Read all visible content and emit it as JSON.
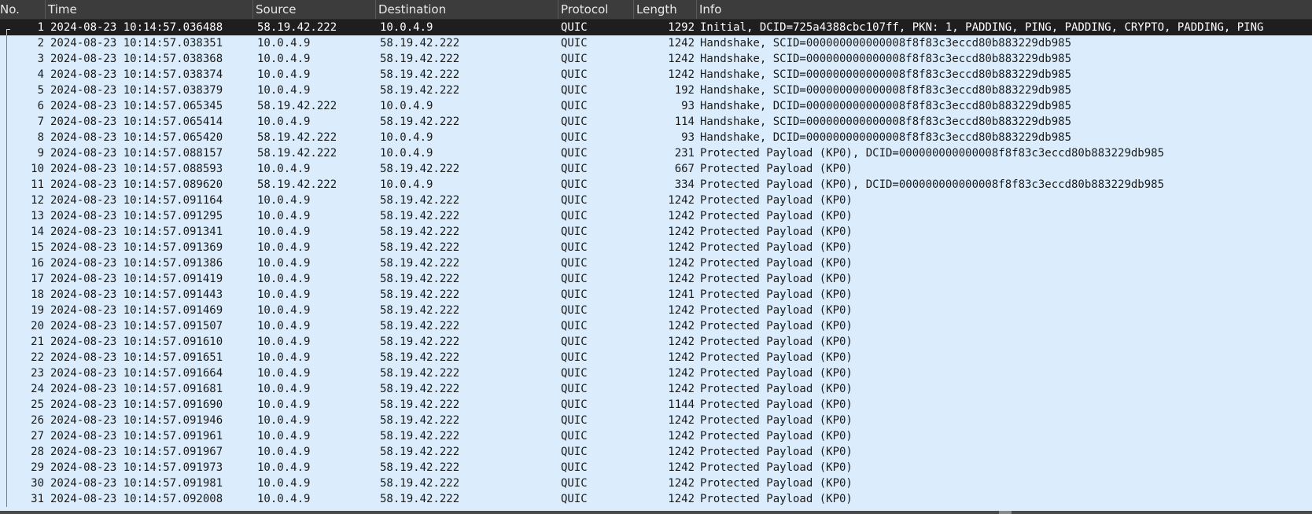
{
  "columns": {
    "no": "No.",
    "time": "Time",
    "source": "Source",
    "destination": "Destination",
    "protocol": "Protocol",
    "length": "Length",
    "info": "Info"
  },
  "selected_row": 1,
  "packets": [
    {
      "no": "1",
      "time": "2024-08-23 10:14:57.036488",
      "source": "58.19.42.222",
      "destination": "10.0.4.9",
      "protocol": "QUIC",
      "length": "1292",
      "info": "Initial, DCID=725a4388cbc107ff, PKN: 1, PADDING, PING, PADDING, CRYPTO, PADDING, PING"
    },
    {
      "no": "2",
      "time": "2024-08-23 10:14:57.038351",
      "source": "10.0.4.9",
      "destination": "58.19.42.222",
      "protocol": "QUIC",
      "length": "1242",
      "info": "Handshake, SCID=000000000000008f8f83c3eccd80b883229db985"
    },
    {
      "no": "3",
      "time": "2024-08-23 10:14:57.038368",
      "source": "10.0.4.9",
      "destination": "58.19.42.222",
      "protocol": "QUIC",
      "length": "1242",
      "info": "Handshake, SCID=000000000000008f8f83c3eccd80b883229db985"
    },
    {
      "no": "4",
      "time": "2024-08-23 10:14:57.038374",
      "source": "10.0.4.9",
      "destination": "58.19.42.222",
      "protocol": "QUIC",
      "length": "1242",
      "info": "Handshake, SCID=000000000000008f8f83c3eccd80b883229db985"
    },
    {
      "no": "5",
      "time": "2024-08-23 10:14:57.038379",
      "source": "10.0.4.9",
      "destination": "58.19.42.222",
      "protocol": "QUIC",
      "length": "192",
      "info": "Handshake, SCID=000000000000008f8f83c3eccd80b883229db985"
    },
    {
      "no": "6",
      "time": "2024-08-23 10:14:57.065345",
      "source": "58.19.42.222",
      "destination": "10.0.4.9",
      "protocol": "QUIC",
      "length": "93",
      "info": "Handshake, DCID=000000000000008f8f83c3eccd80b883229db985"
    },
    {
      "no": "7",
      "time": "2024-08-23 10:14:57.065414",
      "source": "10.0.4.9",
      "destination": "58.19.42.222",
      "protocol": "QUIC",
      "length": "114",
      "info": "Handshake, SCID=000000000000008f8f83c3eccd80b883229db985"
    },
    {
      "no": "8",
      "time": "2024-08-23 10:14:57.065420",
      "source": "58.19.42.222",
      "destination": "10.0.4.9",
      "protocol": "QUIC",
      "length": "93",
      "info": "Handshake, DCID=000000000000008f8f83c3eccd80b883229db985"
    },
    {
      "no": "9",
      "time": "2024-08-23 10:14:57.088157",
      "source": "58.19.42.222",
      "destination": "10.0.4.9",
      "protocol": "QUIC",
      "length": "231",
      "info": "Protected Payload (KP0), DCID=000000000000008f8f83c3eccd80b883229db985"
    },
    {
      "no": "10",
      "time": "2024-08-23 10:14:57.088593",
      "source": "10.0.4.9",
      "destination": "58.19.42.222",
      "protocol": "QUIC",
      "length": "667",
      "info": "Protected Payload (KP0)"
    },
    {
      "no": "11",
      "time": "2024-08-23 10:14:57.089620",
      "source": "58.19.42.222",
      "destination": "10.0.4.9",
      "protocol": "QUIC",
      "length": "334",
      "info": "Protected Payload (KP0), DCID=000000000000008f8f83c3eccd80b883229db985"
    },
    {
      "no": "12",
      "time": "2024-08-23 10:14:57.091164",
      "source": "10.0.4.9",
      "destination": "58.19.42.222",
      "protocol": "QUIC",
      "length": "1242",
      "info": "Protected Payload (KP0)"
    },
    {
      "no": "13",
      "time": "2024-08-23 10:14:57.091295",
      "source": "10.0.4.9",
      "destination": "58.19.42.222",
      "protocol": "QUIC",
      "length": "1242",
      "info": "Protected Payload (KP0)"
    },
    {
      "no": "14",
      "time": "2024-08-23 10:14:57.091341",
      "source": "10.0.4.9",
      "destination": "58.19.42.222",
      "protocol": "QUIC",
      "length": "1242",
      "info": "Protected Payload (KP0)"
    },
    {
      "no": "15",
      "time": "2024-08-23 10:14:57.091369",
      "source": "10.0.4.9",
      "destination": "58.19.42.222",
      "protocol": "QUIC",
      "length": "1242",
      "info": "Protected Payload (KP0)"
    },
    {
      "no": "16",
      "time": "2024-08-23 10:14:57.091386",
      "source": "10.0.4.9",
      "destination": "58.19.42.222",
      "protocol": "QUIC",
      "length": "1242",
      "info": "Protected Payload (KP0)"
    },
    {
      "no": "17",
      "time": "2024-08-23 10:14:57.091419",
      "source": "10.0.4.9",
      "destination": "58.19.42.222",
      "protocol": "QUIC",
      "length": "1242",
      "info": "Protected Payload (KP0)"
    },
    {
      "no": "18",
      "time": "2024-08-23 10:14:57.091443",
      "source": "10.0.4.9",
      "destination": "58.19.42.222",
      "protocol": "QUIC",
      "length": "1241",
      "info": "Protected Payload (KP0)"
    },
    {
      "no": "19",
      "time": "2024-08-23 10:14:57.091469",
      "source": "10.0.4.9",
      "destination": "58.19.42.222",
      "protocol": "QUIC",
      "length": "1242",
      "info": "Protected Payload (KP0)"
    },
    {
      "no": "20",
      "time": "2024-08-23 10:14:57.091507",
      "source": "10.0.4.9",
      "destination": "58.19.42.222",
      "protocol": "QUIC",
      "length": "1242",
      "info": "Protected Payload (KP0)"
    },
    {
      "no": "21",
      "time": "2024-08-23 10:14:57.091610",
      "source": "10.0.4.9",
      "destination": "58.19.42.222",
      "protocol": "QUIC",
      "length": "1242",
      "info": "Protected Payload (KP0)"
    },
    {
      "no": "22",
      "time": "2024-08-23 10:14:57.091651",
      "source": "10.0.4.9",
      "destination": "58.19.42.222",
      "protocol": "QUIC",
      "length": "1242",
      "info": "Protected Payload (KP0)"
    },
    {
      "no": "23",
      "time": "2024-08-23 10:14:57.091664",
      "source": "10.0.4.9",
      "destination": "58.19.42.222",
      "protocol": "QUIC",
      "length": "1242",
      "info": "Protected Payload (KP0)"
    },
    {
      "no": "24",
      "time": "2024-08-23 10:14:57.091681",
      "source": "10.0.4.9",
      "destination": "58.19.42.222",
      "protocol": "QUIC",
      "length": "1242",
      "info": "Protected Payload (KP0)"
    },
    {
      "no": "25",
      "time": "2024-08-23 10:14:57.091690",
      "source": "10.0.4.9",
      "destination": "58.19.42.222",
      "protocol": "QUIC",
      "length": "1144",
      "info": "Protected Payload (KP0)"
    },
    {
      "no": "26",
      "time": "2024-08-23 10:14:57.091946",
      "source": "10.0.4.9",
      "destination": "58.19.42.222",
      "protocol": "QUIC",
      "length": "1242",
      "info": "Protected Payload (KP0)"
    },
    {
      "no": "27",
      "time": "2024-08-23 10:14:57.091961",
      "source": "10.0.4.9",
      "destination": "58.19.42.222",
      "protocol": "QUIC",
      "length": "1242",
      "info": "Protected Payload (KP0)"
    },
    {
      "no": "28",
      "time": "2024-08-23 10:14:57.091967",
      "source": "10.0.4.9",
      "destination": "58.19.42.222",
      "protocol": "QUIC",
      "length": "1242",
      "info": "Protected Payload (KP0)"
    },
    {
      "no": "29",
      "time": "2024-08-23 10:14:57.091973",
      "source": "10.0.4.9",
      "destination": "58.19.42.222",
      "protocol": "QUIC",
      "length": "1242",
      "info": "Protected Payload (KP0)"
    },
    {
      "no": "30",
      "time": "2024-08-23 10:14:57.091981",
      "source": "10.0.4.9",
      "destination": "58.19.42.222",
      "protocol": "QUIC",
      "length": "1242",
      "info": "Protected Payload (KP0)"
    },
    {
      "no": "31",
      "time": "2024-08-23 10:14:57.092008",
      "source": "10.0.4.9",
      "destination": "58.19.42.222",
      "protocol": "QUIC",
      "length": "1242",
      "info": "Protected Payload (KP0)"
    }
  ]
}
